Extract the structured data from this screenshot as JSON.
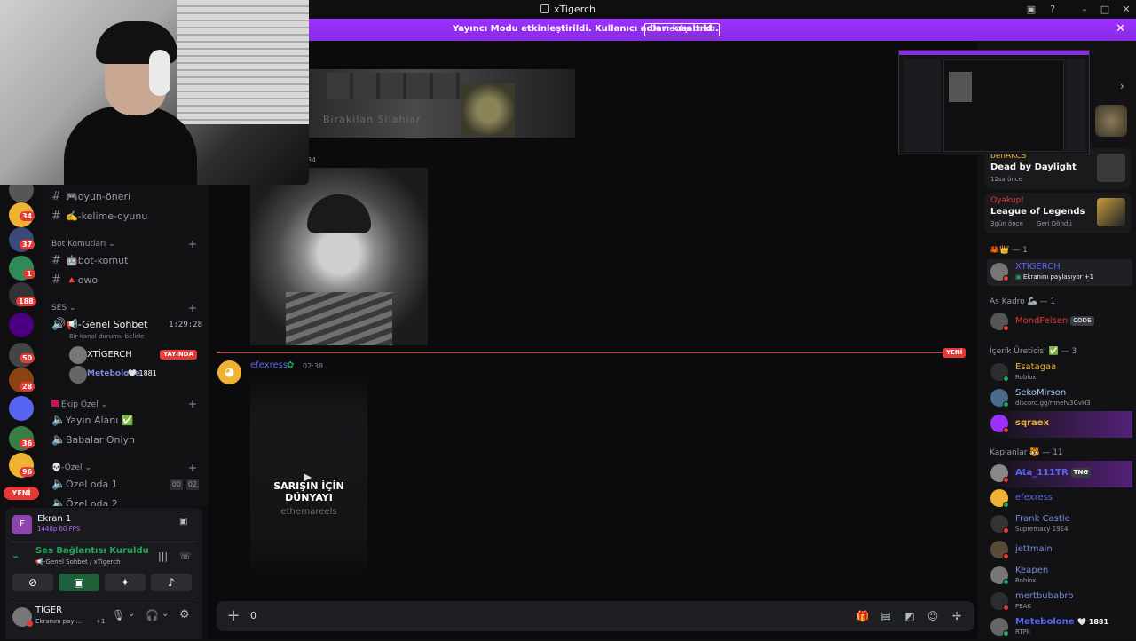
{
  "window": {
    "title": "xTigerch"
  },
  "banner": {
    "message": "Yayıncı Modu etkinleştirildi. Kullanıcı adları kısaltıldı.",
    "button": "Devre dışı bırak"
  },
  "colors": {
    "accent": "#8a2be2",
    "live": "#e53935",
    "online": "#23a55a"
  },
  "rail": {
    "badges": [
      "34",
      "37",
      "1",
      "188",
      "50",
      "28",
      "36",
      "96"
    ],
    "new_pill": "YENİ"
  },
  "channels": {
    "items_top": [
      {
        "label": "🎮oyun-öneri"
      },
      {
        "label": "✍️-kelime-oyunu"
      }
    ],
    "category_bot": "Bot Komutları",
    "items_bot": [
      {
        "label": "🤖bot-komut"
      },
      {
        "label": "🔺owo"
      }
    ],
    "category_voice": "SES",
    "voice_channel": {
      "label": "📢-Genel Sohbet",
      "timer": "1:29:28",
      "status_hint": "Bir kanal durumu belirle"
    },
    "voice_users": [
      {
        "name": "XTİGERCH",
        "badge": "YAYINDA"
      },
      {
        "name": "Metebolone",
        "extra": "🤍 1881"
      }
    ],
    "category_team": "Ekip Özel",
    "team_items": [
      {
        "label": "Yayın Alanı ✅"
      },
      {
        "label": "Babalar Onlyn"
      }
    ],
    "category_private": "💀-Özel",
    "private_items": [
      {
        "label": "Özel oda 1",
        "c1": "00",
        "c2": "02"
      },
      {
        "label": "Özel oda 2"
      }
    ]
  },
  "user_panel": {
    "stream_title": "Ekran 1",
    "stream_quality": "1440p 60 FPS",
    "voice_status": "Ses Bağlantısı Kuruldu",
    "voice_channel": "📢-Genel Sohbet / xTigerch",
    "username": "TİGER",
    "user_status": "Ekranını payl...",
    "user_status_extra": "+1"
  },
  "chat": {
    "strip_text": "Birakilan Silahlar",
    "timestamp_partial": "34",
    "new_divider": "YENİ",
    "message": {
      "author": "efexress",
      "time": "02:38"
    },
    "video": {
      "title": "SARIŞIN İÇİN DÜNYAYI",
      "subtitle": "ethernareels"
    },
    "composer_value": "0"
  },
  "activity_cards": [
    {
      "name": "benAKCS",
      "game": "Dead by Daylight",
      "time": "12sa önce",
      "name_color": "#f0b232"
    },
    {
      "name": "Oyakup!",
      "game": "League of Legends",
      "time": "3gün önce",
      "extra": "Geri Döndü",
      "name_color": "#e53935"
    }
  ],
  "members": {
    "group_top": "🦀👑 — 1",
    "top": [
      {
        "name": "XTİGERCH",
        "status": "Ekranını paylaşıyor",
        "extra": "+1",
        "color": "#5865f2"
      }
    ],
    "group_as": "As Kadro 🦾 — 1",
    "as": [
      {
        "name": "MondFelsen",
        "tag": "CODE",
        "color": "#e53935"
      }
    ],
    "group_creator": "İçerik Üreticisi ✅ — 3",
    "creator": [
      {
        "name": "Esatagaa",
        "status": "Roblox",
        "color": "#f0b232"
      },
      {
        "name": "SekoMirson",
        "status": "discord.gg/mnefv3GvH3",
        "color": "#a8c8ff"
      },
      {
        "name": "sqraex",
        "color": "#f0b232"
      }
    ],
    "group_kaplan": "Kaplanlar 🐯 — 11",
    "kaplan": [
      {
        "name": "Ata_111TR",
        "tag": "TNG",
        "color": "#5865f2"
      },
      {
        "name": "efexress",
        "color": "#5865f2"
      },
      {
        "name": "Frank Castle",
        "status": "Supremacy 1914",
        "color": "#7289da"
      },
      {
        "name": "jettmain",
        "color": "#7289da"
      },
      {
        "name": "Keapen",
        "status": "Roblox",
        "color": "#7289da"
      },
      {
        "name": "mertbubabro",
        "status": "PEAK",
        "color": "#7289da"
      },
      {
        "name": "Metebolone",
        "extra": "🤍 1881",
        "status": "RTPk",
        "color": "#5865f2"
      }
    ]
  }
}
